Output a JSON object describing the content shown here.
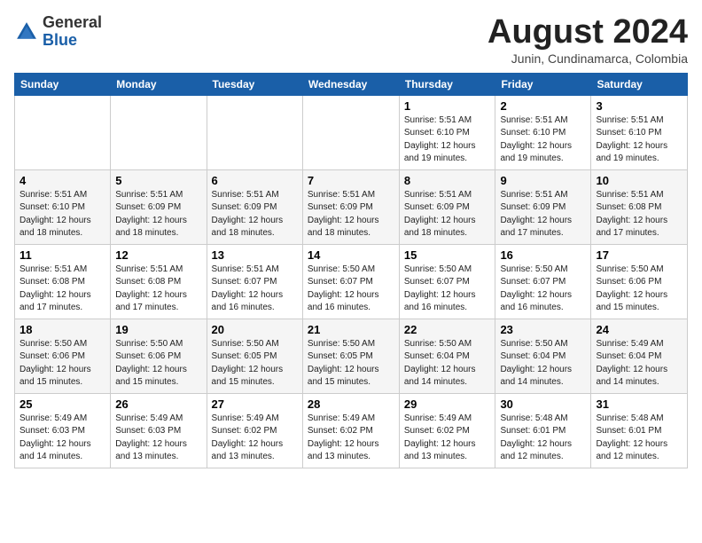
{
  "header": {
    "logo_general": "General",
    "logo_blue": "Blue",
    "title": "August 2024",
    "subtitle": "Junin, Cundinamarca, Colombia"
  },
  "weekdays": [
    "Sunday",
    "Monday",
    "Tuesday",
    "Wednesday",
    "Thursday",
    "Friday",
    "Saturday"
  ],
  "weeks": [
    [
      {
        "day": "",
        "info": ""
      },
      {
        "day": "",
        "info": ""
      },
      {
        "day": "",
        "info": ""
      },
      {
        "day": "",
        "info": ""
      },
      {
        "day": "1",
        "info": "Sunrise: 5:51 AM\nSunset: 6:10 PM\nDaylight: 12 hours\nand 19 minutes."
      },
      {
        "day": "2",
        "info": "Sunrise: 5:51 AM\nSunset: 6:10 PM\nDaylight: 12 hours\nand 19 minutes."
      },
      {
        "day": "3",
        "info": "Sunrise: 5:51 AM\nSunset: 6:10 PM\nDaylight: 12 hours\nand 19 minutes."
      }
    ],
    [
      {
        "day": "4",
        "info": "Sunrise: 5:51 AM\nSunset: 6:10 PM\nDaylight: 12 hours\nand 18 minutes."
      },
      {
        "day": "5",
        "info": "Sunrise: 5:51 AM\nSunset: 6:09 PM\nDaylight: 12 hours\nand 18 minutes."
      },
      {
        "day": "6",
        "info": "Sunrise: 5:51 AM\nSunset: 6:09 PM\nDaylight: 12 hours\nand 18 minutes."
      },
      {
        "day": "7",
        "info": "Sunrise: 5:51 AM\nSunset: 6:09 PM\nDaylight: 12 hours\nand 18 minutes."
      },
      {
        "day": "8",
        "info": "Sunrise: 5:51 AM\nSunset: 6:09 PM\nDaylight: 12 hours\nand 18 minutes."
      },
      {
        "day": "9",
        "info": "Sunrise: 5:51 AM\nSunset: 6:09 PM\nDaylight: 12 hours\nand 17 minutes."
      },
      {
        "day": "10",
        "info": "Sunrise: 5:51 AM\nSunset: 6:08 PM\nDaylight: 12 hours\nand 17 minutes."
      }
    ],
    [
      {
        "day": "11",
        "info": "Sunrise: 5:51 AM\nSunset: 6:08 PM\nDaylight: 12 hours\nand 17 minutes."
      },
      {
        "day": "12",
        "info": "Sunrise: 5:51 AM\nSunset: 6:08 PM\nDaylight: 12 hours\nand 17 minutes."
      },
      {
        "day": "13",
        "info": "Sunrise: 5:51 AM\nSunset: 6:07 PM\nDaylight: 12 hours\nand 16 minutes."
      },
      {
        "day": "14",
        "info": "Sunrise: 5:50 AM\nSunset: 6:07 PM\nDaylight: 12 hours\nand 16 minutes."
      },
      {
        "day": "15",
        "info": "Sunrise: 5:50 AM\nSunset: 6:07 PM\nDaylight: 12 hours\nand 16 minutes."
      },
      {
        "day": "16",
        "info": "Sunrise: 5:50 AM\nSunset: 6:07 PM\nDaylight: 12 hours\nand 16 minutes."
      },
      {
        "day": "17",
        "info": "Sunrise: 5:50 AM\nSunset: 6:06 PM\nDaylight: 12 hours\nand 15 minutes."
      }
    ],
    [
      {
        "day": "18",
        "info": "Sunrise: 5:50 AM\nSunset: 6:06 PM\nDaylight: 12 hours\nand 15 minutes."
      },
      {
        "day": "19",
        "info": "Sunrise: 5:50 AM\nSunset: 6:06 PM\nDaylight: 12 hours\nand 15 minutes."
      },
      {
        "day": "20",
        "info": "Sunrise: 5:50 AM\nSunset: 6:05 PM\nDaylight: 12 hours\nand 15 minutes."
      },
      {
        "day": "21",
        "info": "Sunrise: 5:50 AM\nSunset: 6:05 PM\nDaylight: 12 hours\nand 15 minutes."
      },
      {
        "day": "22",
        "info": "Sunrise: 5:50 AM\nSunset: 6:04 PM\nDaylight: 12 hours\nand 14 minutes."
      },
      {
        "day": "23",
        "info": "Sunrise: 5:50 AM\nSunset: 6:04 PM\nDaylight: 12 hours\nand 14 minutes."
      },
      {
        "day": "24",
        "info": "Sunrise: 5:49 AM\nSunset: 6:04 PM\nDaylight: 12 hours\nand 14 minutes."
      }
    ],
    [
      {
        "day": "25",
        "info": "Sunrise: 5:49 AM\nSunset: 6:03 PM\nDaylight: 12 hours\nand 14 minutes."
      },
      {
        "day": "26",
        "info": "Sunrise: 5:49 AM\nSunset: 6:03 PM\nDaylight: 12 hours\nand 13 minutes."
      },
      {
        "day": "27",
        "info": "Sunrise: 5:49 AM\nSunset: 6:02 PM\nDaylight: 12 hours\nand 13 minutes."
      },
      {
        "day": "28",
        "info": "Sunrise: 5:49 AM\nSunset: 6:02 PM\nDaylight: 12 hours\nand 13 minutes."
      },
      {
        "day": "29",
        "info": "Sunrise: 5:49 AM\nSunset: 6:02 PM\nDaylight: 12 hours\nand 13 minutes."
      },
      {
        "day": "30",
        "info": "Sunrise: 5:48 AM\nSunset: 6:01 PM\nDaylight: 12 hours\nand 12 minutes."
      },
      {
        "day": "31",
        "info": "Sunrise: 5:48 AM\nSunset: 6:01 PM\nDaylight: 12 hours\nand 12 minutes."
      }
    ]
  ]
}
